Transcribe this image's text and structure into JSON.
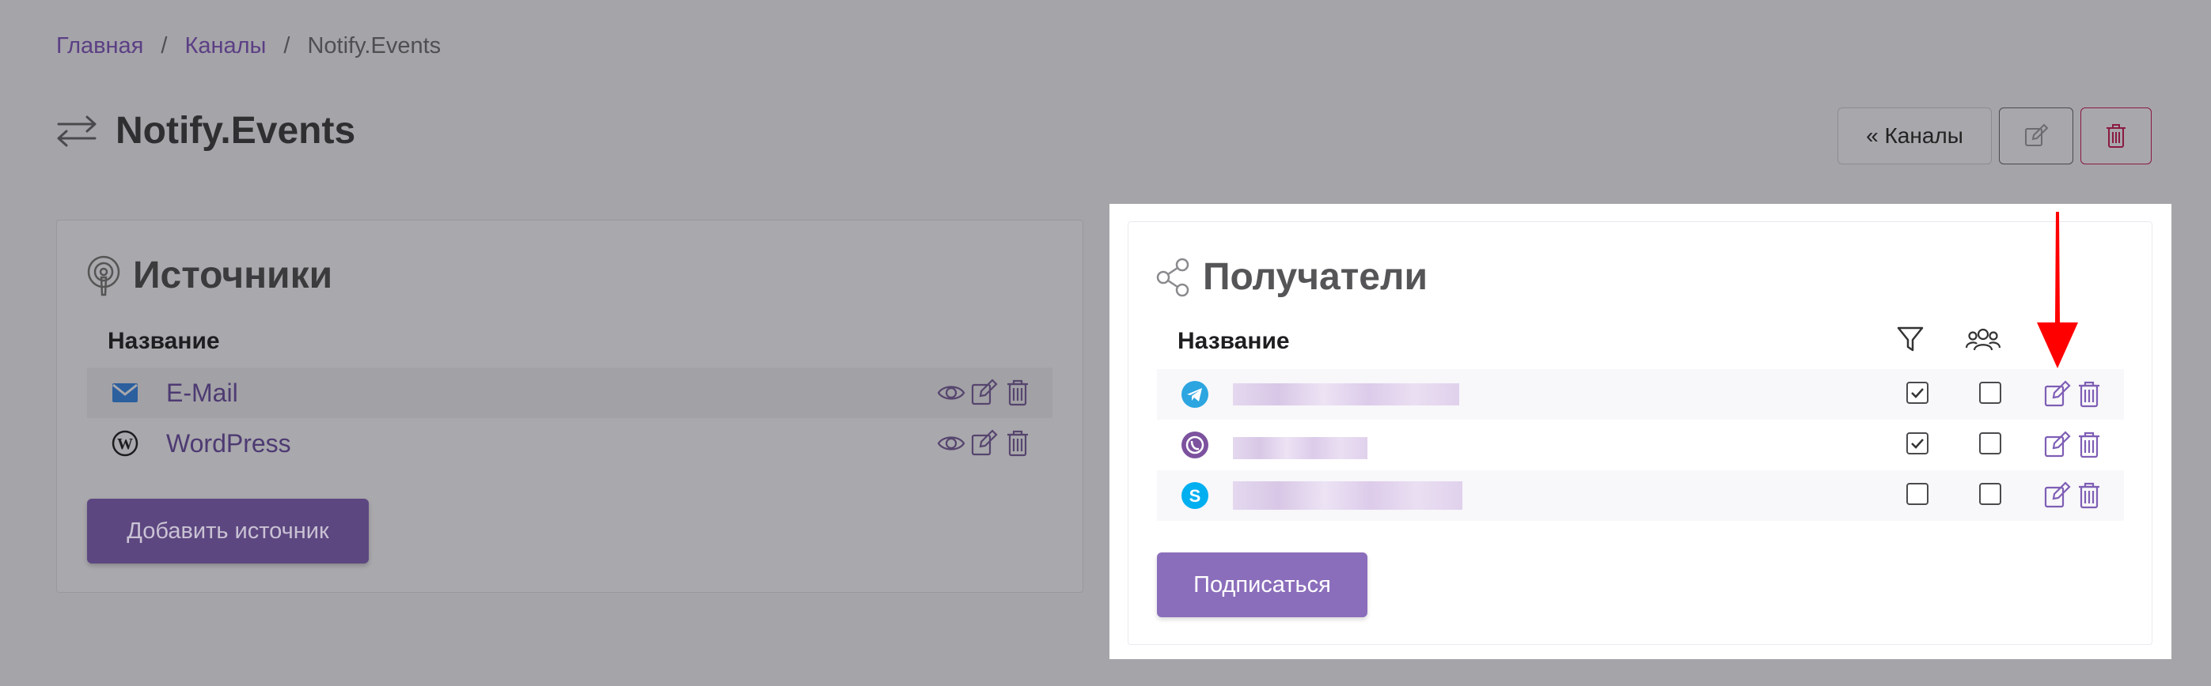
{
  "breadcrumb": {
    "home": "Главная",
    "channels": "Каналы",
    "current": "Notify.Events",
    "separator": "/"
  },
  "page": {
    "title": "Notify.Events",
    "channels_button": "« Каналы"
  },
  "sources": {
    "title": "Источники",
    "column_name": "Название",
    "items": [
      {
        "name": "E-Mail",
        "icon": "mail-icon"
      },
      {
        "name": "WordPress",
        "icon": "wordpress-icon"
      }
    ],
    "add_button": "Добавить источник"
  },
  "recipients": {
    "title": "Получатели",
    "column_name": "Название",
    "column_filter_icon": "filter-icon",
    "column_group_icon": "users-icon",
    "items": [
      {
        "service": "telegram",
        "filter": true,
        "group": false
      },
      {
        "service": "viber",
        "filter": true,
        "group": false
      },
      {
        "service": "skype",
        "filter": false,
        "group": false
      }
    ],
    "subscribe_button": "Подписаться"
  },
  "colors": {
    "accent": "#8b6ebb",
    "link": "#5b3f84",
    "danger": "#e0245e",
    "arrow": "#ff0000"
  }
}
